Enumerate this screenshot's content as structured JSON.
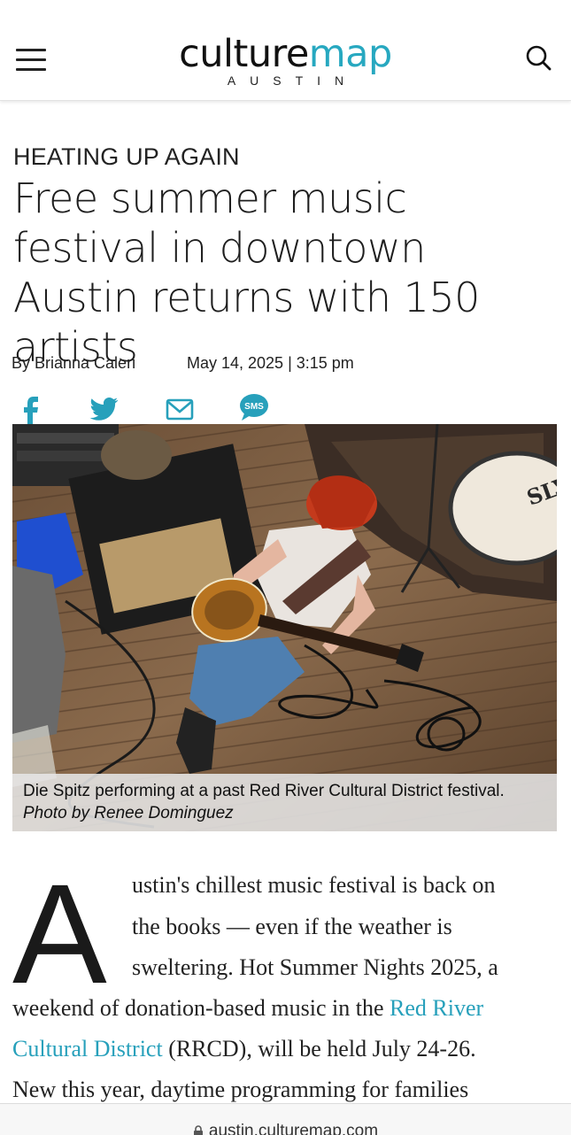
{
  "header": {
    "logo_culture": "culture",
    "logo_map": "map",
    "logo_city": "AUSTIN",
    "menu_icon": "hamburger-menu-icon",
    "search_icon": "search-icon"
  },
  "article": {
    "kicker": "HEATING UP AGAIN",
    "headline": "Free summer music festival in downtown Austin returns with 150 artists",
    "byline": "By Brianna Caleri",
    "date": "May 14, 2025 | 3:15 pm"
  },
  "share": {
    "facebook_icon": "facebook-icon",
    "twitter_icon": "twitter-icon",
    "email_icon": "email-icon",
    "sms_icon": "sms-icon",
    "sms_label": "SMS"
  },
  "photo": {
    "caption": "Die Spitz performing at a past Red River Cultural District festival.",
    "credit": "Photo by Renee Dominguez"
  },
  "body": {
    "dropcap": "A",
    "line1": "ustin's chillest music festival is back on",
    "line2": "the books — even if the weather is",
    "line3": "sweltering. Hot Summer Nights 2025, a",
    "line4": "weekend of donation-based music in the",
    "link1": "Red River",
    "link2": "Cultural District",
    "line5_rest": "(RRCD), will be held July 24-26.",
    "line6": "New this year, daytime programming for families"
  },
  "browser": {
    "url": "austin.culturemap.com",
    "lock_icon": "lock-icon"
  },
  "colors": {
    "brand_teal": "#27a8c0",
    "link": "#27a0bb",
    "text": "#222222"
  }
}
